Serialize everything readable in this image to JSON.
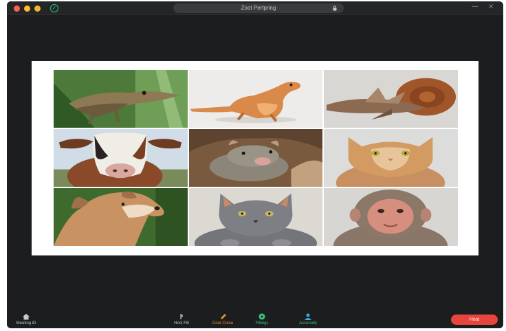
{
  "window": {
    "title": "Zoot Pertpring",
    "controls": {
      "minimize": "—",
      "close": "×"
    }
  },
  "gallery": {
    "tiles": [
      {
        "subject": "lizard"
      },
      {
        "subject": "gecko"
      },
      {
        "subject": "snail"
      },
      {
        "subject": "cow"
      },
      {
        "subject": "rat"
      },
      {
        "subject": "cat"
      },
      {
        "subject": "dog"
      },
      {
        "subject": "grey-cat"
      },
      {
        "subject": "monkey"
      }
    ]
  },
  "toolbar": {
    "meeting_label": "Meeting iD",
    "host_fill_label": "Host Fill",
    "dut_label": "Dnut Coioa",
    "fill_label": "Fitlings",
    "acc_label": "Accenolly",
    "host_button": "Host"
  },
  "colors": {
    "background": "#1c1d1f",
    "accent_orange": "#e8913a",
    "accent_green": "#3cc47c",
    "host_red": "#e8453c"
  }
}
